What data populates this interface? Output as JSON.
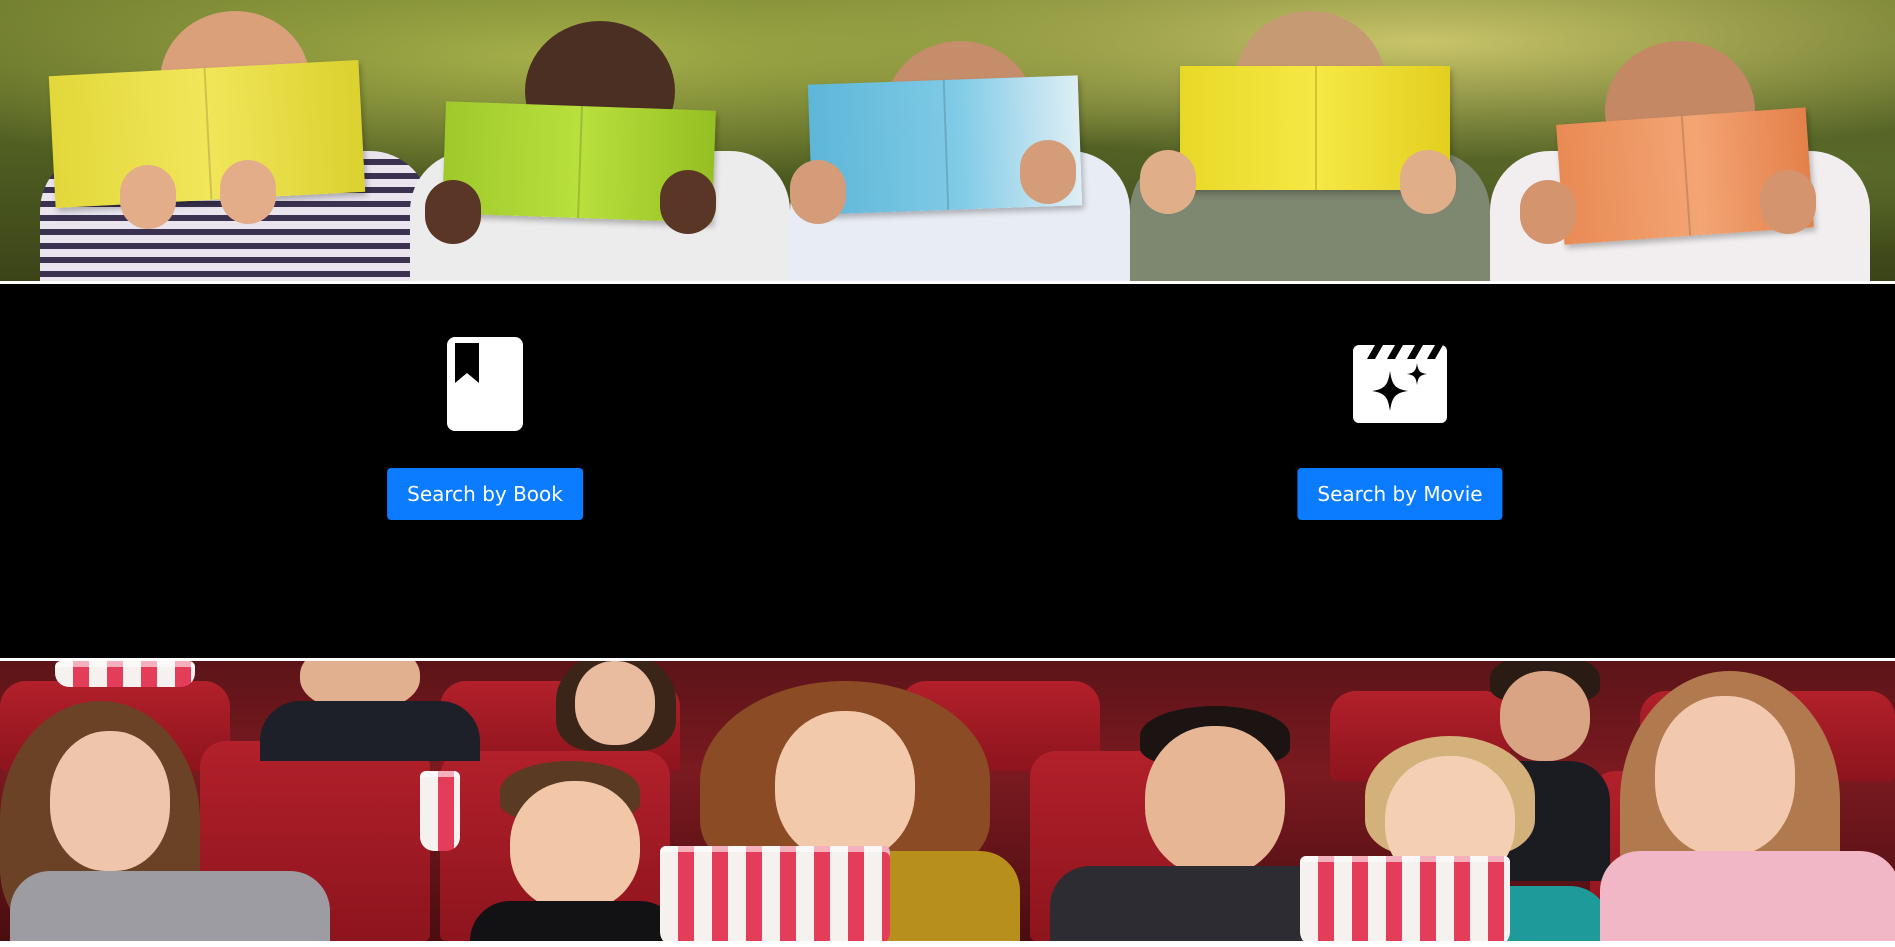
{
  "banner_top": {
    "icon": "kids-reading-photo"
  },
  "options": {
    "book": {
      "icon": "book-bookmark-icon",
      "button_label": "Search by Book"
    },
    "movie": {
      "icon": "film-clapper-sparkles-icon",
      "button_label": "Search by Movie"
    }
  },
  "banner_bottom": {
    "icon": "cinema-audience-photo"
  },
  "colors": {
    "panel_background": "#000000",
    "button_background": "#0b7bff",
    "button_text": "#ffffff",
    "icon_fill": "#ffffff"
  }
}
